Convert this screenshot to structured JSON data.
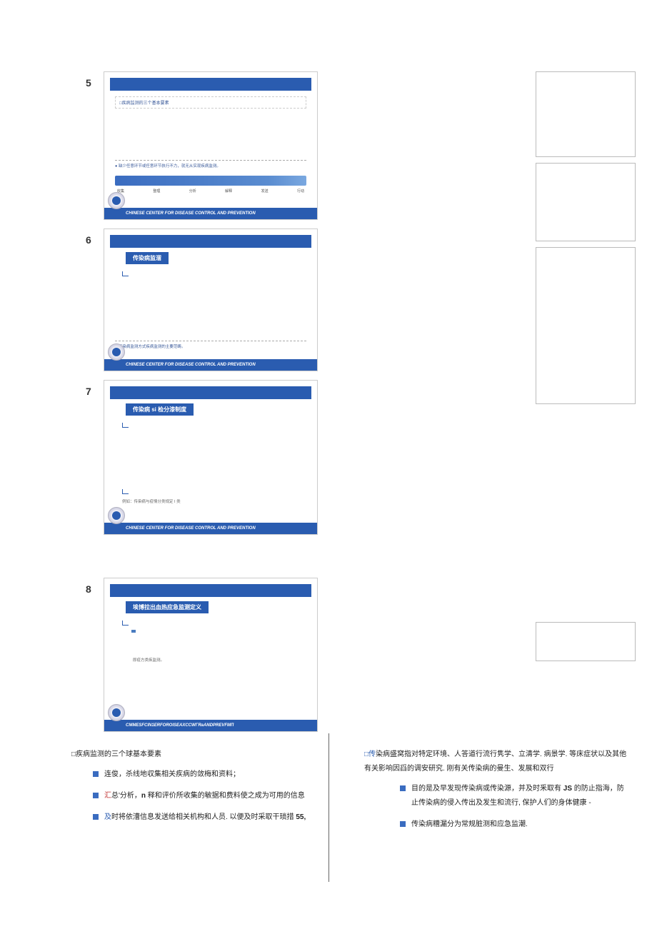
{
  "slides": [
    {
      "num": "5",
      "subtitle": "□疾病监测的三个基本要素",
      "note": "● 缺少任意环节或任意环节执行不力，就无从实现疾病监测。",
      "flow": [
        "收集",
        "整理",
        "分析",
        "解释",
        "发送",
        "行动"
      ],
      "footer": "CHINESE CENTER FOR DISEASE CONTROL AND PREVENTION"
    },
    {
      "num": "6",
      "title": "传染病监溜",
      "note": "● 传染病监测方式疾病监测的主要范畴。",
      "footer": "CHINESE CENTER FOR DISEASE CONTROL AND PREVENTION"
    },
    {
      "num": "7",
      "title": "传染病 si 检分漆制度",
      "small": "例如：传染病与疫情分类规定 I 类",
      "footer": "CHINESE CENTER FOR DISEASE CONTROL AND PREVENTION"
    },
    {
      "num": "8",
      "title": "埃博拉出血热应急监测定义",
      "small": "即疫方类疾监测。",
      "footer": "CMMESFCIN1ERFOROISEAXCCWГRаANDPREVFMП"
    }
  ],
  "notes_left": {
    "heading": "□疾病监测的三个球基本要素",
    "items": [
      "连俊，杀线地収集相关疾病的敛梅和资料；",
      "汇总'分析，n 释和评价所收集的敏据和费料使之成为可用的信息",
      "及时将依漕信息发送给相关机构和人员. 以便及时采取干琐措 55,"
    ]
  },
  "notes_right": {
    "heading_pre": "□传",
    "heading": "染病盛窝指对特定环境、人答道行流行隽学、立清学. 病景学. 等床症状以及其他有关影响因舀的调安研究. 刚有关传染病的曼生、发展和双行",
    "items": [
      "目的是及早发现传染病或传染源，并及时釆取有 JS 的防止指海，防止传染病的侵入传出及发生和流行, 保护人们的身体健康 -",
      "传染病糟漏分为常规脏测和应急监潮."
    ]
  }
}
